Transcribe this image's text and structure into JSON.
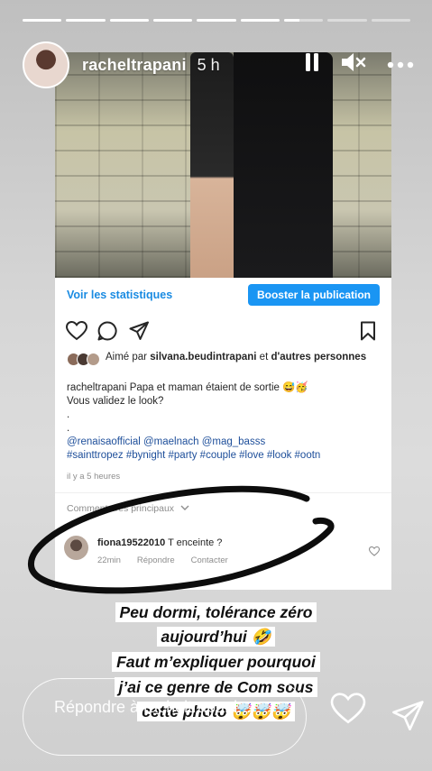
{
  "story": {
    "progress_segments": [
      1,
      1,
      1,
      1,
      1,
      1,
      0.4,
      0,
      0
    ],
    "username": "racheltrapani",
    "time": "5 h"
  },
  "header_icons": [
    "pause-icon",
    "mute-icon",
    "more-icon"
  ],
  "post": {
    "stats_link": "Voir les statistiques",
    "boost_button": "Booster la publication",
    "liked_prefix": "Aimé par",
    "liked_user": "silvana.beudintrapani",
    "liked_mid": "et",
    "liked_others": "d'autres personnes",
    "caption_user": "racheltrapani",
    "caption_text": "Papa et maman étaient de sortie 😅🥳",
    "caption_line2": "Vous validez le look?",
    "caption_dot1": ".",
    "caption_dot2": ".",
    "mentions": "@renaisaofficial @maelnach @mag_basss",
    "hashtags": "#sainttropez #bynight #party #couple #love #look #ootn",
    "time_ago": "il y a 5 heures",
    "top_comments": "Commentaires principaux",
    "comment": {
      "user": "fiona19522010",
      "text": "T enceinte ?",
      "time": "22min",
      "reply": "Répondre",
      "contact": "Contacter"
    }
  },
  "overlay": {
    "line1": "Peu dormi, tolérance zéro",
    "line2": "aujourd’hui 🤣",
    "line3": "Faut m’expliquer pourquoi",
    "line4": "j’ai ce genre de Com sous",
    "line5": "cette photo 🤯🤯🤯"
  },
  "reply_bar": {
    "placeholder": "Répondre à racheltrapani..."
  }
}
